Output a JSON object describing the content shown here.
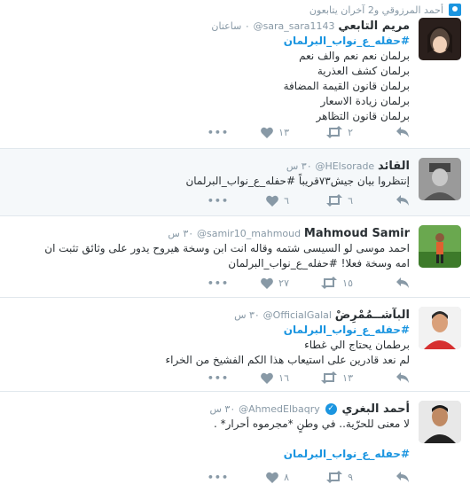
{
  "context_line": "أحمد المرزوقي و2 آخران يتابعون",
  "tweets": [
    {
      "name": "مريم التابعي",
      "handle": "@sara_sara1143",
      "time": "٠ ساعتان",
      "lines": [
        "#حفله_ع_نواب_البرلمان",
        "برلمان نعم نعم والف نعم",
        "برلمان كشف العذرية",
        "برلمان قانون القيمة المضافة",
        "برلمان زيادة الاسعار",
        "برلمان قانون التظاهر"
      ],
      "retweets": "٢",
      "likes": "١٣"
    },
    {
      "name": "القائد",
      "handle": "@HElsorade",
      "time": "٣٠ س",
      "lines": [
        "إنتظروا بيان جيش٧٣قريباً  #حفله_ع_نواب_البرلمان"
      ],
      "retweets": "٦",
      "likes": "٦"
    },
    {
      "name": "Mahmoud Samir",
      "handle": "@samir10_mahmoud",
      "time": "٣٠ س",
      "lines": [
        "احمد موسى لو السيسى شتمه وقاله انت ابن وسخة هيروح يدور على وثائق تثبت ان",
        "امه وسخة فعلا! #حفله_ع_نواب_البرلمان"
      ],
      "retweets": "١٥",
      "likes": "٢٧"
    },
    {
      "name": "البآشــمُمْرِضْ",
      "handle": "@OfficialGalal",
      "time": "٣٠ س",
      "lines": [
        "#حفله_ع_نواب_البرلمان",
        "برطمان يحتاج الي غطاء",
        "لم نعد قادرين على استيعاب هذا الكم الفشيخ من الخراء"
      ],
      "retweets": "١٣",
      "likes": "١٦"
    },
    {
      "name": "أحمد البغري",
      "handle": "@AhmedElbaqry",
      "time": "٣٠ س",
      "lines": [
        "لا معنى للحرّية.. في وطنٍ *مجرموه أحرار* .",
        "",
        "#حفله_ع_نواب_البرلمان"
      ],
      "retweets": "٩",
      "likes": "٨"
    }
  ]
}
